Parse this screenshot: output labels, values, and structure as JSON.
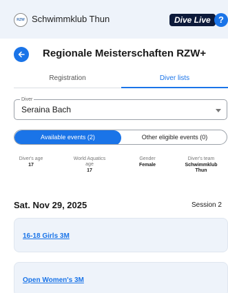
{
  "header": {
    "club_logo_text": "RZW",
    "club_name": "Schwimmklub Thun",
    "dive_live_label": "Dive Live",
    "help_label": "?"
  },
  "meet": {
    "title": "Regionale Meisterschaften RZW+"
  },
  "tabs": {
    "registration": "Registration",
    "diver_lists": "Diver lists",
    "active": "diver_lists"
  },
  "diver_select": {
    "label": "Diver",
    "value": "Seraina Bach"
  },
  "event_toggle": {
    "available": "Available events (2)",
    "other": "Other eligible events (0)",
    "active": "available"
  },
  "diver_info": [
    {
      "label": "Diver's age",
      "value": "17"
    },
    {
      "label": "World Aquatics age",
      "value": "17"
    },
    {
      "label": "Gender",
      "value": "Female"
    },
    {
      "label": "Diver's team",
      "value": "Schwimmklub Thun"
    }
  ],
  "schedule": {
    "date": "Sat. Nov 29, 2025",
    "session": "Session 2",
    "events": [
      {
        "name": "16-18 Girls 3M"
      },
      {
        "name": "Open Women's 3M"
      }
    ]
  }
}
